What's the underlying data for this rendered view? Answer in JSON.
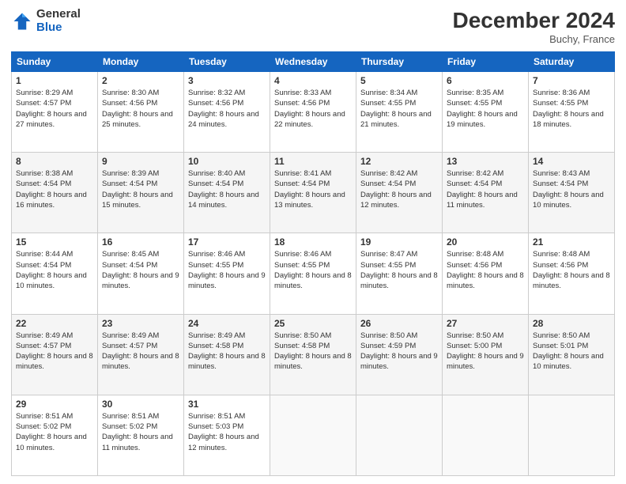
{
  "header": {
    "logo_line1": "General",
    "logo_line2": "Blue",
    "month": "December 2024",
    "location": "Buchy, France"
  },
  "weekdays": [
    "Sunday",
    "Monday",
    "Tuesday",
    "Wednesday",
    "Thursday",
    "Friday",
    "Saturday"
  ],
  "weeks": [
    [
      {
        "day": "1",
        "sunrise": "8:29 AM",
        "sunset": "4:57 PM",
        "daylight": "8 hours and 27 minutes."
      },
      {
        "day": "2",
        "sunrise": "8:30 AM",
        "sunset": "4:56 PM",
        "daylight": "8 hours and 25 minutes."
      },
      {
        "day": "3",
        "sunrise": "8:32 AM",
        "sunset": "4:56 PM",
        "daylight": "8 hours and 24 minutes."
      },
      {
        "day": "4",
        "sunrise": "8:33 AM",
        "sunset": "4:56 PM",
        "daylight": "8 hours and 22 minutes."
      },
      {
        "day": "5",
        "sunrise": "8:34 AM",
        "sunset": "4:55 PM",
        "daylight": "8 hours and 21 minutes."
      },
      {
        "day": "6",
        "sunrise": "8:35 AM",
        "sunset": "4:55 PM",
        "daylight": "8 hours and 19 minutes."
      },
      {
        "day": "7",
        "sunrise": "8:36 AM",
        "sunset": "4:55 PM",
        "daylight": "8 hours and 18 minutes."
      }
    ],
    [
      {
        "day": "8",
        "sunrise": "8:38 AM",
        "sunset": "4:54 PM",
        "daylight": "8 hours and 16 minutes."
      },
      {
        "day": "9",
        "sunrise": "8:39 AM",
        "sunset": "4:54 PM",
        "daylight": "8 hours and 15 minutes."
      },
      {
        "day": "10",
        "sunrise": "8:40 AM",
        "sunset": "4:54 PM",
        "daylight": "8 hours and 14 minutes."
      },
      {
        "day": "11",
        "sunrise": "8:41 AM",
        "sunset": "4:54 PM",
        "daylight": "8 hours and 13 minutes."
      },
      {
        "day": "12",
        "sunrise": "8:42 AM",
        "sunset": "4:54 PM",
        "daylight": "8 hours and 12 minutes."
      },
      {
        "day": "13",
        "sunrise": "8:42 AM",
        "sunset": "4:54 PM",
        "daylight": "8 hours and 11 minutes."
      },
      {
        "day": "14",
        "sunrise": "8:43 AM",
        "sunset": "4:54 PM",
        "daylight": "8 hours and 10 minutes."
      }
    ],
    [
      {
        "day": "15",
        "sunrise": "8:44 AM",
        "sunset": "4:54 PM",
        "daylight": "8 hours and 10 minutes."
      },
      {
        "day": "16",
        "sunrise": "8:45 AM",
        "sunset": "4:54 PM",
        "daylight": "8 hours and 9 minutes."
      },
      {
        "day": "17",
        "sunrise": "8:46 AM",
        "sunset": "4:55 PM",
        "daylight": "8 hours and 9 minutes."
      },
      {
        "day": "18",
        "sunrise": "8:46 AM",
        "sunset": "4:55 PM",
        "daylight": "8 hours and 8 minutes."
      },
      {
        "day": "19",
        "sunrise": "8:47 AM",
        "sunset": "4:55 PM",
        "daylight": "8 hours and 8 minutes."
      },
      {
        "day": "20",
        "sunrise": "8:48 AM",
        "sunset": "4:56 PM",
        "daylight": "8 hours and 8 minutes."
      },
      {
        "day": "21",
        "sunrise": "8:48 AM",
        "sunset": "4:56 PM",
        "daylight": "8 hours and 8 minutes."
      }
    ],
    [
      {
        "day": "22",
        "sunrise": "8:49 AM",
        "sunset": "4:57 PM",
        "daylight": "8 hours and 8 minutes."
      },
      {
        "day": "23",
        "sunrise": "8:49 AM",
        "sunset": "4:57 PM",
        "daylight": "8 hours and 8 minutes."
      },
      {
        "day": "24",
        "sunrise": "8:49 AM",
        "sunset": "4:58 PM",
        "daylight": "8 hours and 8 minutes."
      },
      {
        "day": "25",
        "sunrise": "8:50 AM",
        "sunset": "4:58 PM",
        "daylight": "8 hours and 8 minutes."
      },
      {
        "day": "26",
        "sunrise": "8:50 AM",
        "sunset": "4:59 PM",
        "daylight": "8 hours and 9 minutes."
      },
      {
        "day": "27",
        "sunrise": "8:50 AM",
        "sunset": "5:00 PM",
        "daylight": "8 hours and 9 minutes."
      },
      {
        "day": "28",
        "sunrise": "8:50 AM",
        "sunset": "5:01 PM",
        "daylight": "8 hours and 10 minutes."
      }
    ],
    [
      {
        "day": "29",
        "sunrise": "8:51 AM",
        "sunset": "5:02 PM",
        "daylight": "8 hours and 10 minutes."
      },
      {
        "day": "30",
        "sunrise": "8:51 AM",
        "sunset": "5:02 PM",
        "daylight": "8 hours and 11 minutes."
      },
      {
        "day": "31",
        "sunrise": "8:51 AM",
        "sunset": "5:03 PM",
        "daylight": "8 hours and 12 minutes."
      },
      null,
      null,
      null,
      null
    ]
  ]
}
